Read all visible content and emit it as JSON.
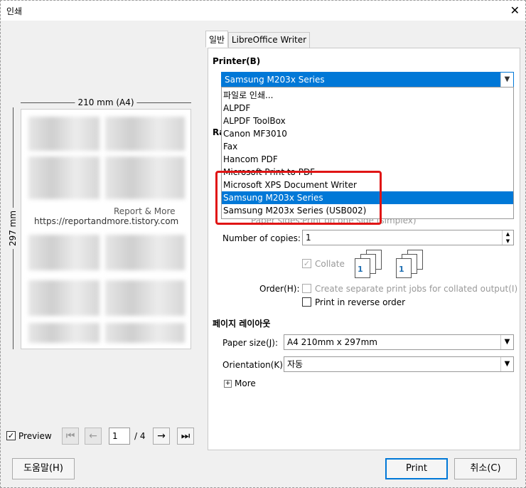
{
  "window": {
    "title": "인쇄",
    "close_symbol": "✕"
  },
  "tabs": [
    {
      "label": "일반"
    },
    {
      "label": "LibreOffice Writer"
    }
  ],
  "preview": {
    "width_label": "210 mm (A4)",
    "height_label": "297 mm",
    "watermark_line1": "Report & More",
    "watermark_line2": "https://reportandmore.tistory.com",
    "preview_checkbox_label": "Preview",
    "current_page": "1",
    "total_pages": "/ 4"
  },
  "printer": {
    "section_title": "Printer(B)",
    "selected": "Samsung M203x Series",
    "dropdown_items": [
      "파일로 인쇄...",
      "ALPDF",
      "ALPDF ToolBox",
      "Canon MF3010",
      "Fax",
      "Hancom PDF",
      "Microsoft Print to PDF",
      "Microsoft XPS Document Writer",
      "Samsung M203x Series",
      "Samsung M203x Series (USB002)"
    ],
    "partial_label": "Ra",
    "paper_sides_label": "Paper sides:",
    "paper_sides_value": "Print on one side (simplex)"
  },
  "copies": {
    "label": "Number of copies:",
    "value": "1",
    "collate_label": "Collate",
    "order_label": "Order(H):",
    "separate_jobs_label": "Create separate print jobs for collated output(I)",
    "reverse_label": "Print in reverse order"
  },
  "page_layout": {
    "section_title": "페이지 레이아웃",
    "paper_size_label": "Paper size(J):",
    "paper_size_value": "A4 210mm x 297mm",
    "orientation_label": "Orientation(K):",
    "orientation_value": "자동",
    "more_label": "More"
  },
  "buttons": {
    "help": "도움말(H)",
    "print": "Print",
    "cancel": "취소(C)"
  }
}
